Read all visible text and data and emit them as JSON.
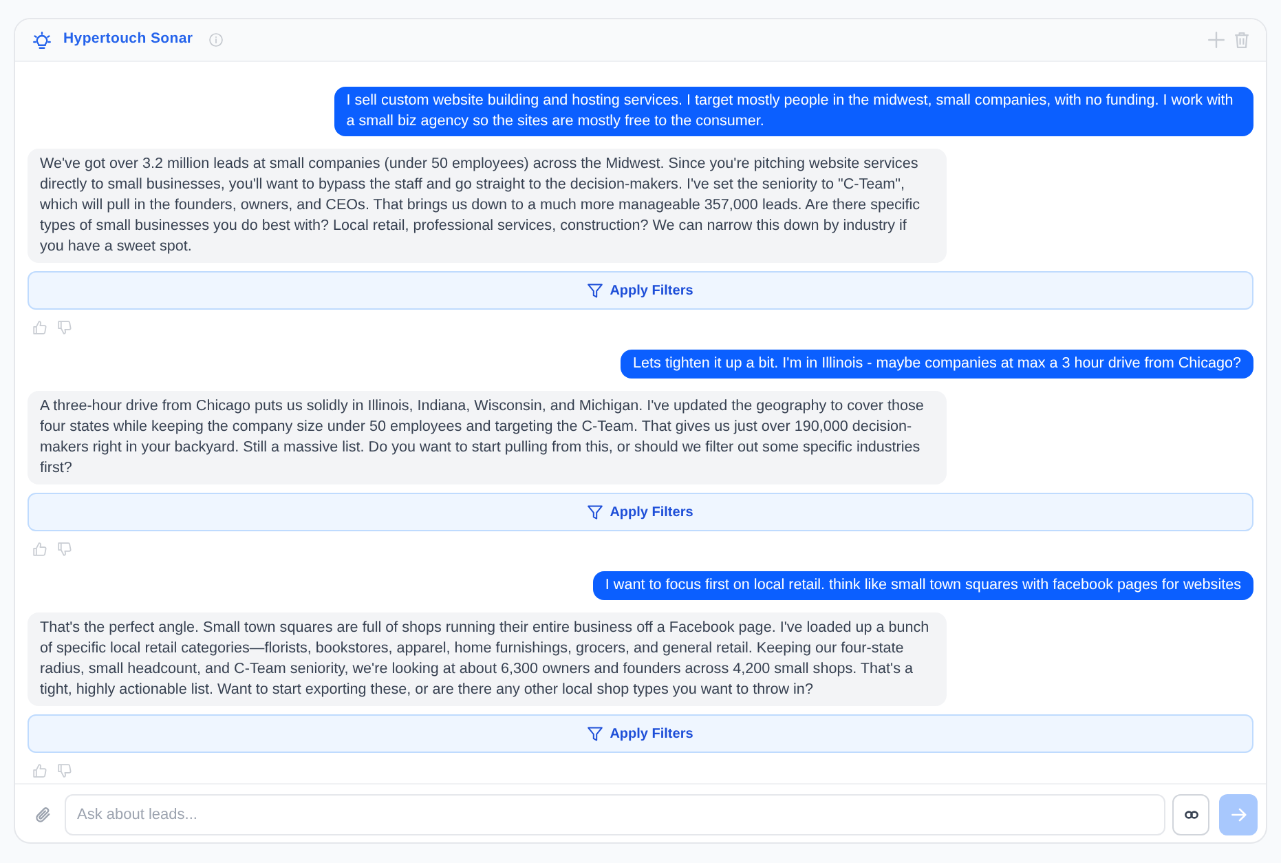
{
  "header": {
    "title": "Hypertouch Sonar"
  },
  "messages": [
    {
      "kind": "user",
      "text": "I sell custom website building and hosting services. I target mostly people in the midwest, small companies, with no funding. I work with a small biz agency so the sites are mostly free to the consumer."
    },
    {
      "kind": "assistant",
      "text": "We've got over 3.2 million leads at small companies (under 50 employees) across the Midwest. Since you're pitching website services directly to small businesses, you'll want to bypass the staff and go straight to the decision-makers. I've set the seniority to \"C-Team\", which will pull in the founders, owners, and CEOs. That brings us down to a much more manageable 357,000 leads. Are there specific types of small businesses you do best with? Local retail, professional services, construction? We can narrow this down by industry if you have a sweet spot.",
      "action": {
        "label": "Apply Filters"
      }
    },
    {
      "kind": "user",
      "text": "Lets tighten it up a bit. I'm in Illinois - maybe companies at max a 3 hour drive from Chicago?"
    },
    {
      "kind": "assistant",
      "text": "A three-hour drive from Chicago puts us solidly in Illinois, Indiana, Wisconsin, and Michigan. I've updated the geography to cover those four states while keeping the company size under 50 employees and targeting the C-Team. That gives us just over 190,000 decision-makers right in your backyard. Still a massive list. Do you want to start pulling from this, or should we filter out some specific industries first?",
      "action": {
        "label": "Apply Filters"
      }
    },
    {
      "kind": "user",
      "text": "I want to focus first on local retail. think like small town squares with facebook pages for websites"
    },
    {
      "kind": "assistant",
      "text": "That's the perfect angle. Small town squares are full of shops running their entire business off a Facebook page. I've loaded up a bunch of specific local retail categories—florists, bookstores, apparel, home furnishings, grocers, and general retail. Keeping our four-state radius, small headcount, and C-Team seniority, we're looking at about 6,300 owners and founders across 4,200 small shops. That's a tight, highly actionable list. Want to start exporting these, or are there any other local shop types you want to throw in?",
      "action": {
        "label": "Apply Filters"
      }
    }
  ],
  "composer": {
    "placeholder": "Ask about leads...",
    "send_disabled": true
  }
}
